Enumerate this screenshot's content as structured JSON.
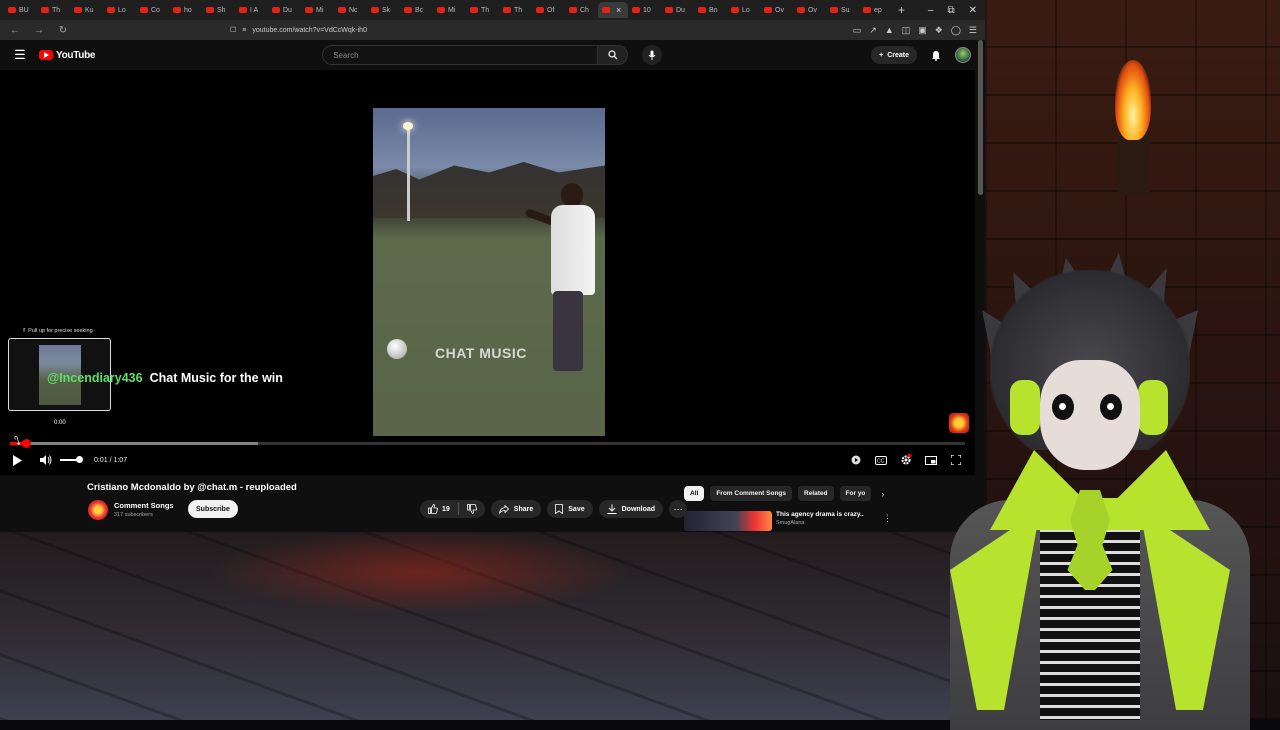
{
  "browser": {
    "tabs": [
      "BU",
      "Th",
      "Ku",
      "Lo",
      "Co",
      "ho",
      "Sh",
      "I A",
      "Du",
      "Mi",
      "Nc",
      "Sk",
      "Bc",
      "Mi",
      "Th",
      "Th",
      "Of",
      "Ch",
      "",
      "10",
      "Du",
      "Bn",
      "Lo",
      "Ov",
      "Ov",
      "Su",
      "ep"
    ],
    "active_tab_index": 18,
    "url": "youtube.com/watch?v=VdCcWqk-ih0"
  },
  "youtube": {
    "logo_text": "YouTube",
    "search_placeholder": "Search",
    "create_label": "Create"
  },
  "player": {
    "video_watermark": "CHAT MUSIC",
    "seek_hint": "⇑ Pull up for precise seeking",
    "seek_preview_time": "0:00",
    "chat_username": "@Incendiary436",
    "chat_message": "Chat Music for the win",
    "current_time": "0:01",
    "duration": "1:07",
    "time_display": "0:01 / 1:07",
    "progress_fraction": 0.015,
    "buffered_fraction": 0.26
  },
  "video": {
    "title": "Cristiano Mcdonaldo by @chat.m - reuploaded",
    "channel_name": "Comment Songs",
    "subscribers": "317 subscribers",
    "subscribe_label": "Subscribe",
    "like_count": "19",
    "share_label": "Share",
    "save_label": "Save",
    "download_label": "Download"
  },
  "sidebar": {
    "chips": [
      "All",
      "From Comment Songs",
      "Related",
      "For yo"
    ],
    "recommendation": {
      "title": "This agency drama is crazy..",
      "channel": "SmugAlana"
    }
  },
  "colors": {
    "youtube_red": "#ff0000",
    "chat_username_green": "#5ee06a",
    "avatar_accent": "#b7e32e"
  }
}
